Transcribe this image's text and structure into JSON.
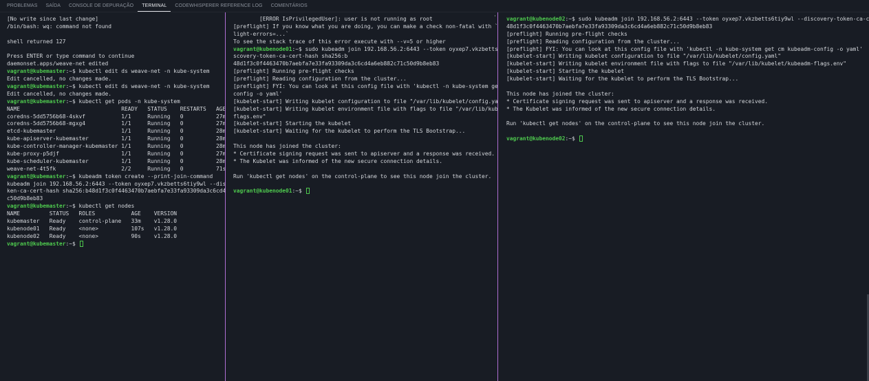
{
  "tabs": [
    {
      "label": "PROBLEMAS",
      "active": false
    },
    {
      "label": "SAÍDA",
      "active": false
    },
    {
      "label": "CONSOLE DE DEPURAÇÃO",
      "active": false
    },
    {
      "label": "TERMINAL",
      "active": true
    },
    {
      "label": "CODEWHISPERER REFERENCE LOG",
      "active": false
    },
    {
      "label": "COMENTÁRIOS",
      "active": false
    }
  ],
  "colors": {
    "prompt_user": "#4ec94e",
    "pane_divider": "#b06fd4",
    "background": "#181c24"
  },
  "panes": [
    {
      "name": "kubemaster",
      "lines": [
        {
          "text": "[No write since last change]"
        },
        {
          "text": "/bin/bash: wq: command not found"
        },
        {
          "text": ""
        },
        {
          "text": "shell returned 127"
        },
        {
          "text": ""
        },
        {
          "text": "Press ENTER or type command to continue"
        },
        {
          "text": "daemonset.apps/weave-net edited"
        },
        {
          "user": "vagrant@kubemaster",
          "text": ":~$ kubectl edit ds weave-net -n kube-system"
        },
        {
          "text": "Edit cancelled, no changes made."
        },
        {
          "user": "vagrant@kubemaster",
          "text": ":~$ kubectl edit ds weave-net -n kube-system"
        },
        {
          "text": "Edit cancelled, no changes made."
        },
        {
          "user": "vagrant@kubemaster",
          "text": ":~$ kubectl get pods -n kube-system"
        },
        {
          "text": "NAME                               READY   STATUS    RESTARTS   AGE"
        },
        {
          "text": "coredns-5dd5756b68-4skvf           1/1     Running   0          27m"
        },
        {
          "text": "coredns-5dd5756b68-mgxg4           1/1     Running   0          27m"
        },
        {
          "text": "etcd-kubemaster                    1/1     Running   0          28m"
        },
        {
          "text": "kube-apiserver-kubemaster          1/1     Running   0          28m"
        },
        {
          "text": "kube-controller-manager-kubemaster 1/1     Running   0          28m"
        },
        {
          "text": "kube-proxy-p5djf                   1/1     Running   0          27m"
        },
        {
          "text": "kube-scheduler-kubemaster          1/1     Running   0          28m"
        },
        {
          "text": "weave-net-4t5fk                    2/2     Running   0          71s"
        },
        {
          "user": "vagrant@kubemaster",
          "text": ":~$ kubeadm token create --print-join-command"
        },
        {
          "text": "kubeadm join 192.168.56.2:6443 --token oyxep7.vkzbetts6tiy9wl --discovery-to"
        },
        {
          "text": "ken-ca-cert-hash sha256:b48d1f3c0f4463470b7aebfa7e33fa93309da3c6cd4a6eb882c71"
        },
        {
          "text": "c50d9b8eb83"
        },
        {
          "user": "vagrant@kubemaster",
          "text": ":~$ kubectl get nodes"
        },
        {
          "text": "NAME         STATUS   ROLES           AGE    VERSION"
        },
        {
          "text": "kubemaster   Ready    control-plane   33m    v1.28.0"
        },
        {
          "text": "kubenode01   Ready    <none>          107s   v1.28.0"
        },
        {
          "text": "kubenode02   Ready    <none>          90s    v1.28.0"
        },
        {
          "user": "vagrant@kubemaster",
          "text": ":~$ ",
          "cursor": true
        }
      ]
    },
    {
      "name": "kubenode01",
      "lines": [
        {
          "text": "        [ERROR IsPrivilegedUser]: user is not running as root"
        },
        {
          "text": "[preflight] If you know what you are doing, you can make a check non-fatal with `--ignore-pref"
        },
        {
          "text": "light-errors=...`"
        },
        {
          "text": "To see the stack trace of this error execute with --v=5 or higher"
        },
        {
          "user": "vagrant@kubenode01",
          "text": ":~$ sudo kubeadm join 192.168.56.2:6443 --token oyxep7.vkzbetts6tiy9wl --di"
        },
        {
          "text": "scovery-token-ca-cert-hash sha256:b"
        },
        {
          "text": "48d1f3c0f4463470b7aebfa7e33fa93309da3c6cd4a6eb882c71c50d9b8eb83"
        },
        {
          "text": "[preflight] Running pre-flight checks"
        },
        {
          "text": "[preflight] Reading configuration from the cluster..."
        },
        {
          "text": "[preflight] FYI: You can look at this config file with 'kubectl -n kube-system get cm kubeadm-"
        },
        {
          "text": "config -o yaml'"
        },
        {
          "text": "[kubelet-start] Writing kubelet configuration to file \"/var/lib/kubelet/config.yaml\""
        },
        {
          "text": "[kubelet-start] Writing kubelet environment file with flags to file \"/var/lib/kubelet/kubeadm-"
        },
        {
          "text": "flags.env\""
        },
        {
          "text": "[kubelet-start] Starting the kubelet"
        },
        {
          "text": "[kubelet-start] Waiting for the kubelet to perform the TLS Bootstrap..."
        },
        {
          "text": ""
        },
        {
          "text": "This node has joined the cluster:"
        },
        {
          "text": "* Certificate signing request was sent to apiserver and a response was received."
        },
        {
          "text": "* The Kubelet was informed of the new secure connection details."
        },
        {
          "text": ""
        },
        {
          "text": "Run 'kubectl get nodes' on the control-plane to see this node join the cluster."
        },
        {
          "text": ""
        },
        {
          "user": "vagrant@kubenode01",
          "text": ":~$ ",
          "cursor": true
        }
      ]
    },
    {
      "name": "kubenode02",
      "lines": [
        {
          "user": "vagrant@kubenode02",
          "text": ":~$ sudo kubeadm join 192.168.56.2:6443 --token oyxep7.vkzbetts6tiy9wl --discovery-token-ca-cert-hash sha256:b"
        },
        {
          "text": "48d1f3c0f4463470b7aebfa7e33fa93309da3c6cd4a6eb882c71c50d9b8eb83"
        },
        {
          "text": "[preflight] Running pre-flight checks"
        },
        {
          "text": "[preflight] Reading configuration from the cluster..."
        },
        {
          "text": "[preflight] FYI: You can look at this config file with 'kubectl -n kube-system get cm kubeadm-config -o yaml'"
        },
        {
          "text": "[kubelet-start] Writing kubelet configuration to file \"/var/lib/kubelet/config.yaml\""
        },
        {
          "text": "[kubelet-start] Writing kubelet environment file with flags to file \"/var/lib/kubelet/kubeadm-flags.env\""
        },
        {
          "text": "[kubelet-start] Starting the kubelet"
        },
        {
          "text": "[kubelet-start] Waiting for the kubelet to perform the TLS Bootstrap..."
        },
        {
          "text": ""
        },
        {
          "text": "This node has joined the cluster:"
        },
        {
          "text": "* Certificate signing request was sent to apiserver and a response was received."
        },
        {
          "text": "* The Kubelet was informed of the new secure connection details."
        },
        {
          "text": ""
        },
        {
          "text": "Run 'kubectl get nodes' on the control-plane to see this node join the cluster."
        },
        {
          "text": ""
        },
        {
          "user": "vagrant@kubenode02",
          "text": ":~$ ",
          "cursor": true
        }
      ]
    }
  ]
}
